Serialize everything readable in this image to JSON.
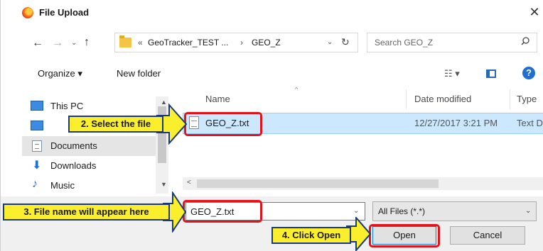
{
  "window": {
    "title": "File Upload",
    "close_glyph": "✕"
  },
  "nav": {
    "back": "←",
    "forward": "→",
    "recent": "⌄",
    "up": "↑"
  },
  "address": {
    "overflow": "«",
    "crumbs": [
      "GeoTracker_TEST ...",
      "GEO_Z"
    ],
    "separator": "›",
    "dropdown": "⌄",
    "refresh": "↻"
  },
  "search": {
    "placeholder": "Search GEO_Z"
  },
  "toolbar": {
    "organize": "Organize ▾",
    "new_folder": "New folder",
    "view": "☷ ▾",
    "help": "?"
  },
  "sidebar": {
    "items": [
      {
        "label": "This PC",
        "icon": "pc-icon"
      },
      {
        "label": "",
        "icon": "desktop-icon"
      },
      {
        "label": "Documents",
        "icon": "documents-icon"
      },
      {
        "label": "Downloads",
        "icon": "downloads-icon"
      },
      {
        "label": "Music",
        "icon": "music-icon"
      }
    ],
    "scroll_up": "▲",
    "scroll_down": "▼"
  },
  "filelist": {
    "columns": [
      "Name",
      "Date modified",
      "Type"
    ],
    "sort_indicator": "^",
    "rows": [
      {
        "name": "GEO_Z.txt",
        "date": "12/27/2017 3:21 PM",
        "type": "Text D"
      }
    ],
    "hscroll_left": "<"
  },
  "bottom": {
    "filename_value": "GEO_Z.txt",
    "filename_dropdown": "⌄",
    "filetype": "All Files (*.*)",
    "filetype_dropdown": "⌄",
    "open": "Open",
    "cancel": "Cancel"
  },
  "callouts": {
    "step2": "2. Select the file",
    "step3": "3. File name will appear here",
    "step4": "4. Click Open"
  },
  "colors": {
    "highlight": "#e3131b",
    "callout_fill": "#fbef2d",
    "callout_border": "#1a3a7a",
    "selection": "#cce8ff"
  }
}
